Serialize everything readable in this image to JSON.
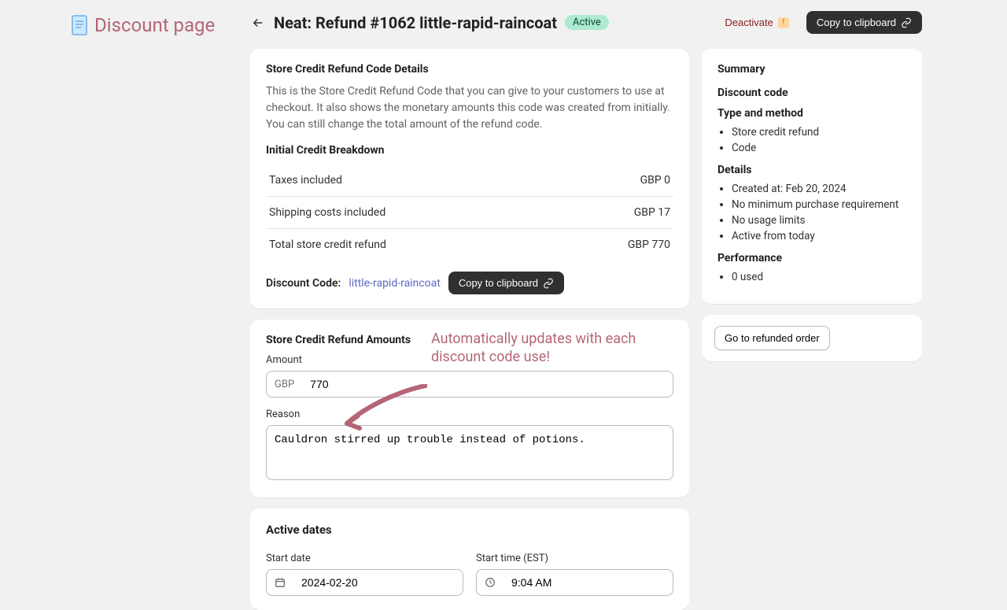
{
  "logo": {
    "text": "Discount page"
  },
  "header": {
    "title": "Neat: Refund #1062 little-rapid-raincoat",
    "status": "Active",
    "deactivate": "Deactivate",
    "copy": "Copy to clipboard"
  },
  "details_card": {
    "title": "Store Credit Refund Code Details",
    "description": "This is the Store Credit Refund Code that you can give to your customers to use at checkout. It also shows the monetary amounts this code was created from initially. You can still change the total amount of the refund code.",
    "breakdown_title": "Initial Credit Breakdown",
    "rows": [
      {
        "label": "Taxes included",
        "value": "GBP 0"
      },
      {
        "label": "Shipping costs included",
        "value": "GBP 17"
      },
      {
        "label": "Total store credit refund",
        "value": "GBP 770"
      }
    ],
    "code_label": "Discount Code:",
    "code_value": "little-rapid-raincoat",
    "copy": "Copy to clipboard"
  },
  "amounts_card": {
    "title": "Store Credit Refund Amounts",
    "annotation": "Automatically updates with each discount code use!",
    "amount_label": "Amount",
    "currency": "GBP",
    "amount_value": "770",
    "reason_label": "Reason",
    "reason_value": "Cauldron stirred up trouble instead of potions."
  },
  "dates_card": {
    "title": "Active dates",
    "start_date_label": "Start date",
    "start_date_value": "2024-02-20",
    "start_time_label": "Start time (EST)",
    "start_time_value": "9:04 AM"
  },
  "summary": {
    "title": "Summary",
    "discount_code_heading": "Discount code",
    "type_heading": "Type and method",
    "type_items": [
      "Store credit refund",
      "Code"
    ],
    "details_heading": "Details",
    "details_items": [
      "Created at: Feb 20, 2024",
      "No minimum purchase requirement",
      "No usage limits",
      "Active from today"
    ],
    "performance_heading": "Performance",
    "performance_items": [
      "0 used"
    ]
  },
  "go_to_order": "Go to refunded order"
}
